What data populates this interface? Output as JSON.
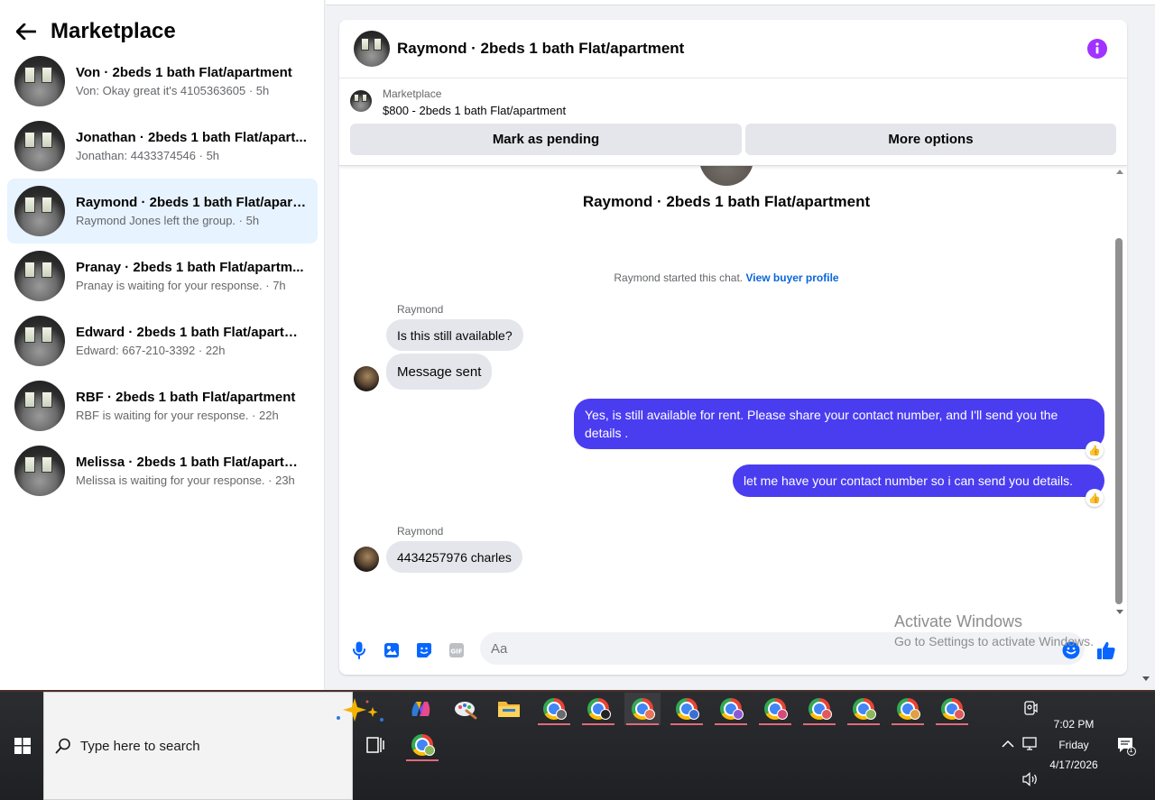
{
  "sidebar": {
    "title": "Marketplace",
    "conversations": [
      {
        "title": "Von · 2beds 1 bath Flat/apartment",
        "subtitle": "Von: Okay great it's 4105363605 · 5h"
      },
      {
        "title": "Jonathan · 2beds 1 bath Flat/apart...",
        "subtitle": "Jonathan: 4433374546 · 5h"
      },
      {
        "title": "Raymond · 2beds 1 bath Flat/apart...",
        "subtitle": "Raymond Jones left the group. · 5h"
      },
      {
        "title": "Pranay · 2beds 1 bath Flat/apartm...",
        "subtitle": "Pranay is waiting for your response. · 7h"
      },
      {
        "title": "Edward · 2beds 1 bath Flat/apartm...",
        "subtitle": "Edward: 667-210-3392 · 22h"
      },
      {
        "title": "RBF · 2beds 1 bath Flat/apartment",
        "subtitle": "RBF is waiting for your response. · 22h"
      },
      {
        "title": "Melissa · 2beds 1 bath Flat/apartm...",
        "subtitle": "Melissa is waiting for your response. · 23h"
      }
    ]
  },
  "chat": {
    "title": "Raymond · 2beds 1 bath Flat/apartment",
    "marketplace_label": "Marketplace",
    "listing": "$800 - 2beds 1 bath Flat/apartment",
    "mark_pending": "Mark as pending",
    "more_options": "More options",
    "thread_title": "Raymond · 2beds 1 bath Flat/apartment",
    "started_text": "Raymond started this chat.",
    "view_profile": "View buyer profile",
    "messages": {
      "sender1": "Raymond",
      "in1": "Is this still available?",
      "in2": "Message sent",
      "out1": "Yes, is still available for rent. Please share your contact number, and I'll send you the details .",
      "out2": "let me have your contact number so i can send you details.",
      "sender2": "Raymond",
      "in3": "4434257976 charles"
    },
    "composer_placeholder": "Aa",
    "accent_color": "#4a3df0"
  },
  "watermark": {
    "line1": "Activate Windows",
    "line2": "Go to Settings to activate Windows."
  },
  "taskbar": {
    "search_placeholder": "Type here to search",
    "time": "7:02 PM",
    "day": "Friday",
    "date": "4/17/2026",
    "notification_count": "1"
  }
}
